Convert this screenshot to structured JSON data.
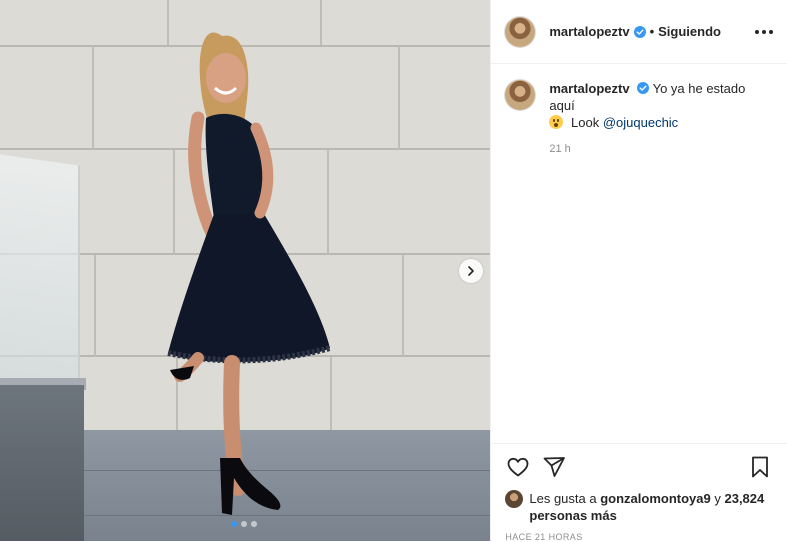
{
  "post": {
    "username": "martalopeztv",
    "follow_sep": "•",
    "follow_status": "Siguiendo",
    "caption_text": "Yo ya he estado aquí",
    "caption_look": "Look",
    "caption_mention": "@ojuquechic",
    "caption_time": "21 h",
    "likes_prefix": "Les gusta a",
    "likes_user": "gonzalomontoya9",
    "likes_and": "y",
    "likes_count": "23,824 personas más",
    "posted_ago": "HACE 21 HORAS"
  },
  "carousel": {
    "total": 3,
    "current": 1
  },
  "colors": {
    "accent": "#3897f0",
    "verified": "#3897f0",
    "text": "#262626",
    "muted": "#8e8e8e",
    "link": "#00376b"
  },
  "icons": [
    "verified-icon",
    "more-options-icon",
    "chevron-right-icon",
    "heart-icon",
    "share-icon",
    "bookmark-icon"
  ]
}
